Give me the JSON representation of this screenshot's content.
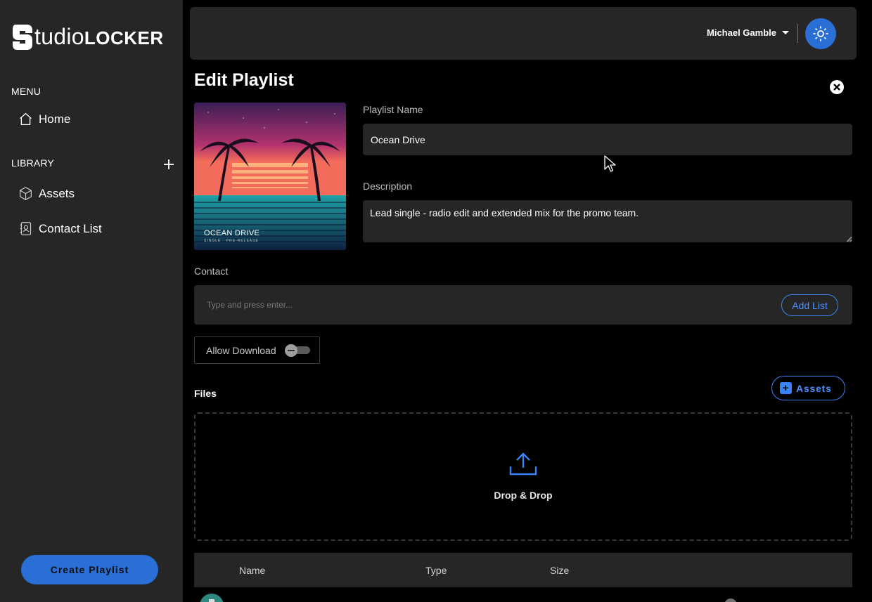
{
  "brand": {
    "logo_prefix": "tudio",
    "logo_suffix": "LOCKER"
  },
  "sidebar": {
    "menu_label": "MENU",
    "library_label": "LIBRARY",
    "menu_items": [
      {
        "label": "Home",
        "icon": "home-icon"
      }
    ],
    "library_items": [
      {
        "label": "Assets",
        "icon": "cube-icon"
      },
      {
        "label": "Contact List",
        "icon": "contact-book-icon"
      }
    ],
    "create_button": "Create Playlist"
  },
  "header": {
    "user_name": "Michael Gamble",
    "theme_icon": "sun-icon"
  },
  "editor": {
    "title": "Edit Playlist",
    "cover": {
      "title": "OCEAN DRIVE",
      "subtitle": "SINGLE · PRE-RELEASE"
    },
    "playlist_name_label": "Playlist Name",
    "playlist_name_value": "Ocean Drive",
    "description_label": "Description",
    "description_value": "Lead single - radio edit and extended mix for the promo team.",
    "contact_label": "Contact",
    "contact_placeholder": "Type and press enter...",
    "add_list_button": "Add List",
    "allow_download_label": "Allow Download",
    "allow_download_enabled": false,
    "files_label": "Files",
    "assets_button": "Assets",
    "dropzone_text": "Drop & Drop"
  },
  "table": {
    "columns": [
      "Name",
      "Type",
      "Size"
    ]
  },
  "colors": {
    "accent": "#2a6fd6",
    "sidebar_bg": "#262626",
    "page_bg": "#000000"
  }
}
